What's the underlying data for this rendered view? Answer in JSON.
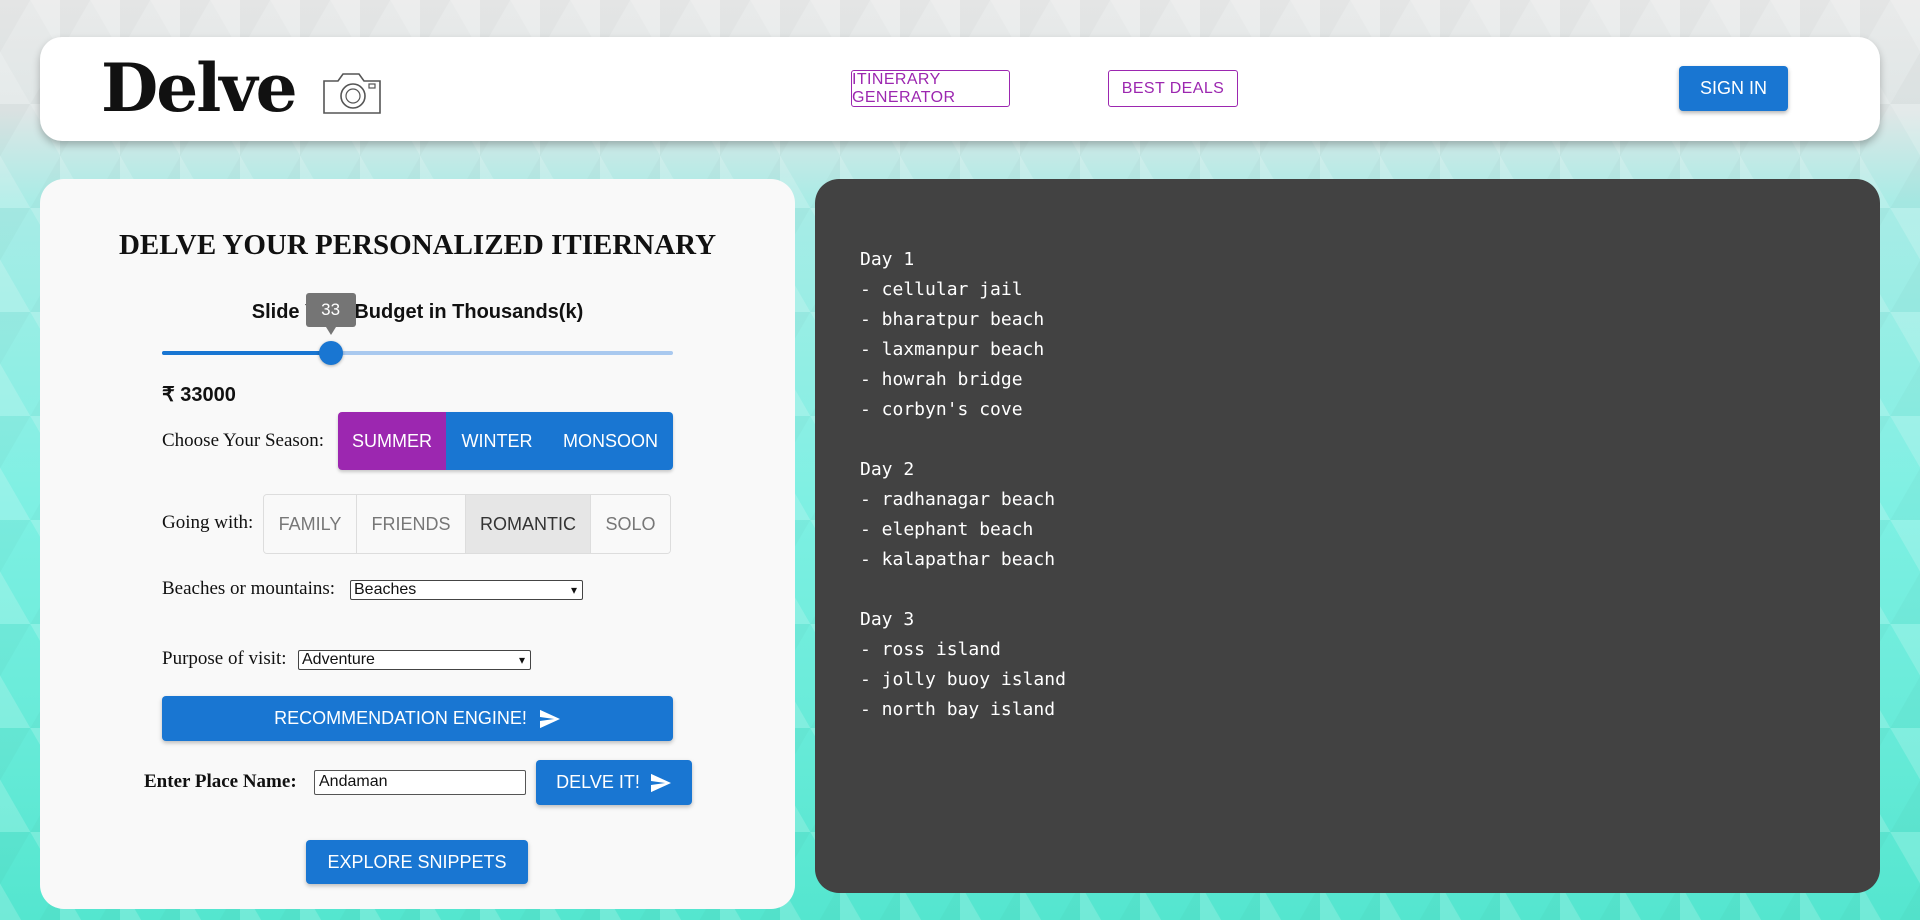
{
  "header": {
    "logo_text": "Delve",
    "nav": [
      "ITINERARY GENERATOR",
      "BEST DEALS"
    ],
    "signin_label": "SIGN IN"
  },
  "form": {
    "title": "DELVE YOUR PERSONALIZED ITIERNARY",
    "slider_label": "Slide Your Budget in Thousands(k)",
    "slider_value": "33",
    "slider_fraction": 0.33,
    "price": "₹ 33000",
    "season_label": "Choose Your Season:",
    "seasons": [
      "SUMMER",
      "WINTER",
      "MONSOON"
    ],
    "season_selected": "SUMMER",
    "going_label": "Going with:",
    "going_options": [
      "FAMILY",
      "FRIENDS",
      "ROMANTIC",
      "SOLO"
    ],
    "going_selected": "ROMANTIC",
    "terrain_label": "Beaches or mountains:",
    "terrain_value": "Beaches",
    "purpose_label": "Purpose of visit:",
    "purpose_value": "Adventure",
    "recommend_label": "RECOMMENDATION ENGINE!",
    "place_label": "Enter Place Name:",
    "place_value": "Andaman",
    "delve_label": "DELVE IT!",
    "explore_label": "EXPLORE SNIPPETS"
  },
  "itinerary": [
    {
      "day": "Day 1",
      "items": [
        "- cellular jail",
        "- bharatpur beach",
        "- laxmanpur beach",
        "- howrah bridge",
        "- corbyn's cove"
      ]
    },
    {
      "day": "Day 2",
      "items": [
        "- radhanagar beach",
        "- elephant beach",
        "- kalapathar beach"
      ]
    },
    {
      "day": "Day 3",
      "items": [
        "- ross island",
        "- jolly buoy island",
        "- north bay island"
      ]
    }
  ],
  "colors": {
    "primary": "#1976d2",
    "accent": "#9c27b0",
    "output_bg": "#424242"
  }
}
